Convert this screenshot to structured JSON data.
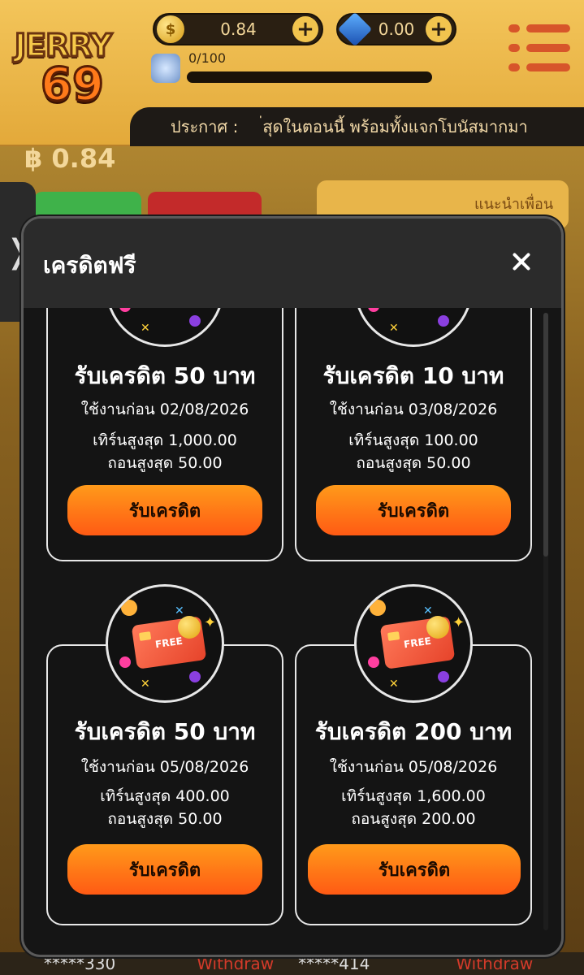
{
  "header": {
    "logo_word": "JERRY",
    "logo_number": "69",
    "coin_balance": "0.84",
    "coin_symbol": "$",
    "gem_balance": "0.00",
    "plus_symbol": "+",
    "level_progress": "0/100",
    "level_fraction": 0.0,
    "announce_label": "ประกาศ :",
    "announce_text": "่สุดในตอนนี้ พร้อมทั้งแจกโบนัสมากมา"
  },
  "background": {
    "balance_text": "฿ 0.84",
    "invite_text": "แนะนำเพื่อน",
    "side_tab_glyph": "❭",
    "ticker": [
      {
        "user": "*****330",
        "action": "Withdraw"
      },
      {
        "user": "*****414",
        "action": "Withdraw"
      }
    ]
  },
  "modal": {
    "title": "เครดิตฟรี",
    "close_glyph": "",
    "badge_text": "FREE",
    "cards": [
      {
        "title": "รับเครดิต 50 บาท",
        "expiry": "ใช้งานก่อน 02/08/2026",
        "max_turnover": "เทิร์นสูงสุด 1,000.00",
        "max_withdraw": "ถอนสูงสุด 50.00",
        "button": "รับเครดิต"
      },
      {
        "title": "รับเครดิต 10 บาท",
        "expiry": "ใช้งานก่อน 03/08/2026",
        "max_turnover": "เทิร์นสูงสุด 100.00",
        "max_withdraw": "ถอนสูงสุด 50.00",
        "button": "รับเครดิต"
      },
      {
        "title": "รับเครดิต 50 บาท",
        "expiry": "ใช้งานก่อน 05/08/2026",
        "max_turnover": "เทิร์นสูงสุด 400.00",
        "max_withdraw": "ถอนสูงสุด 50.00",
        "button": "รับเครดิต"
      },
      {
        "title": "รับเครดิต 200 บาท",
        "expiry": "ใช้งานก่อน 05/08/2026",
        "max_turnover": "เทิร์นสูงสุด 1,600.00",
        "max_withdraw": "ถอนสูงสุด 200.00",
        "button": "รับเครดิต"
      }
    ]
  },
  "colors": {
    "accent_orange": "#ff7a1a",
    "modal_bg": "#262626",
    "card_border": "#e8e8e8"
  }
}
